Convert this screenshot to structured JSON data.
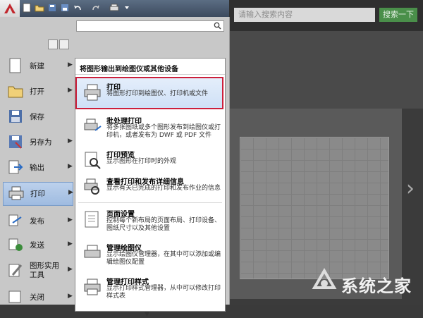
{
  "background": {
    "search_placeholder": "请输入搜索内容",
    "search_button": "搜索一下",
    "watermark": "系统之家"
  },
  "menu": {
    "search_value": "",
    "sections": [
      {
        "label": "新建",
        "icon": "new-document-icon",
        "has_submenu": true
      },
      {
        "label": "打开",
        "icon": "open-folder-icon",
        "has_submenu": true
      },
      {
        "label": "保存",
        "icon": "save-disk-icon",
        "has_submenu": false
      },
      {
        "label": "另存为",
        "icon": "save-as-icon",
        "has_submenu": true
      },
      {
        "label": "输出",
        "icon": "export-icon",
        "has_submenu": true
      },
      {
        "label": "打印",
        "icon": "printer-icon",
        "has_submenu": true,
        "active": true
      },
      {
        "label": "发布",
        "icon": "publish-icon",
        "has_submenu": true
      },
      {
        "label": "发送",
        "icon": "send-icon",
        "has_submenu": true
      },
      {
        "label": "图形实用工具",
        "icon": "drawing-utilities-icon",
        "has_submenu": true
      },
      {
        "label": "关闭",
        "icon": "close-document-icon",
        "has_submenu": true
      }
    ]
  },
  "submenu": {
    "heading": "将图形输出到绘图仪或其他设备",
    "options": [
      {
        "title": "打印",
        "desc": "将图形打印到绘图仪、打印机或文件",
        "icon": "printer-icon",
        "selected": true
      },
      {
        "title": "批处理打印",
        "desc": "将多张图纸或多个图形发布到绘图仪或打印机，或者发布为 DWF 或 PDF 文件",
        "icon": "batch-plot-icon"
      },
      {
        "title": "打印预览",
        "desc": "显示图形在打印时的外观",
        "icon": "plot-preview-icon"
      },
      {
        "title": "查看打印和发布详细信息",
        "desc": "显示有关已完成的打印和发布作业的信息",
        "icon": "plot-details-icon"
      },
      {
        "title": "页面设置",
        "desc": "控制每个新布局的页面布局、打印设备、图纸尺寸以及其他设置",
        "icon": "page-setup-icon"
      },
      {
        "title": "管理绘图仪",
        "desc": "显示绘图仪管理器，在其中可以添加或编辑绘图仪配置",
        "icon": "plotter-manager-icon"
      },
      {
        "title": "管理打印样式",
        "desc": "显示打印样式管理器，从中可以修改打印样式表",
        "icon": "plot-style-manager-icon"
      }
    ]
  }
}
